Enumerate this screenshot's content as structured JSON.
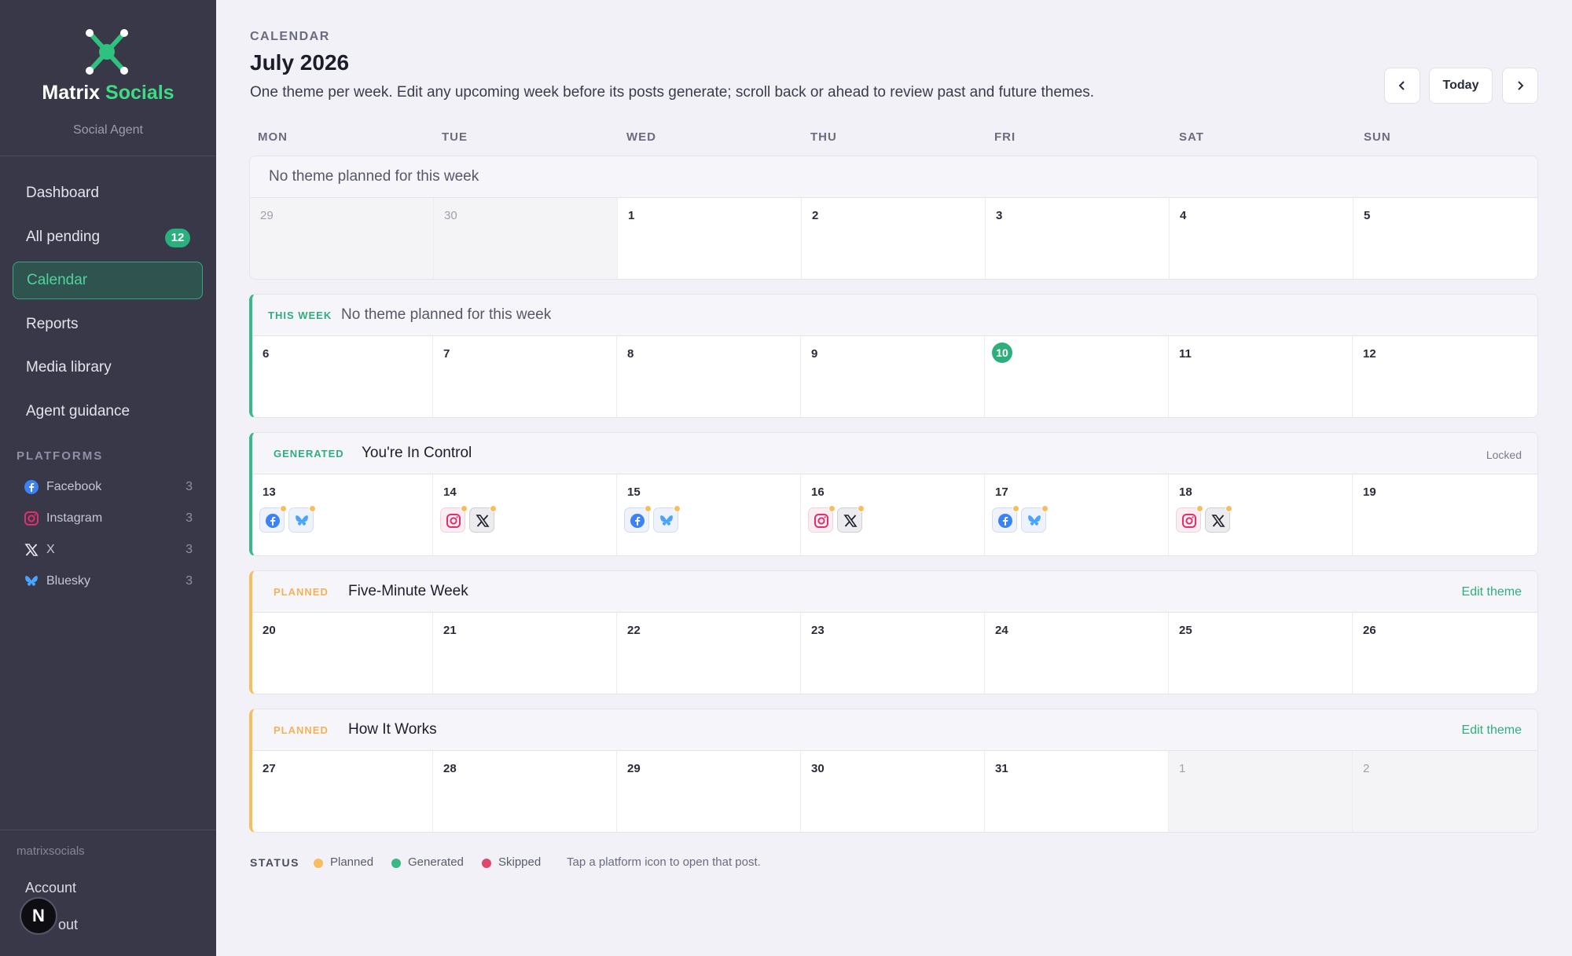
{
  "brand": {
    "name_a": "Matrix",
    "name_b": "Socials",
    "subtitle": "Social Agent"
  },
  "nav": [
    {
      "label": "Dashboard"
    },
    {
      "label": "All pending",
      "badge": "12"
    },
    {
      "label": "Calendar",
      "active": true
    },
    {
      "label": "Reports"
    },
    {
      "label": "Media library"
    },
    {
      "label": "Agent guidance"
    }
  ],
  "platforms_label": "PLATFORMS",
  "platforms": [
    {
      "label": "Facebook",
      "count": "3",
      "icon": "facebook-icon"
    },
    {
      "label": "Instagram",
      "count": "3",
      "icon": "instagram-icon"
    },
    {
      "label": "X",
      "count": "3",
      "icon": "x-icon"
    },
    {
      "label": "Bluesky",
      "count": "3",
      "icon": "bluesky-icon"
    }
  ],
  "footer": {
    "user": "matrixsocials",
    "account": "Account",
    "logout": "out",
    "n_badge": "N"
  },
  "header": {
    "kicker": "CALENDAR",
    "title": "July 2026",
    "description": "One theme per week. Edit any upcoming week before its posts generate; scroll back or ahead to review past and future themes.",
    "prev": "‹",
    "today": "Today",
    "next": "›"
  },
  "weekdays": [
    "MON",
    "TUE",
    "WED",
    "THU",
    "FRI",
    "SAT",
    "SUN"
  ],
  "weeks": [
    {
      "status": "",
      "theme": "No theme planned for this week",
      "right": "",
      "days": [
        "29",
        "30",
        "1",
        "2",
        "3",
        "4",
        "5"
      ]
    },
    {
      "status": "THIS WEEK",
      "theme": "No theme planned for this week",
      "right": "",
      "days": [
        "6",
        "7",
        "8",
        "9",
        "10",
        "11",
        "12"
      ]
    },
    {
      "status": "GENERATED",
      "theme": "You're In Control",
      "right": "Locked",
      "days": [
        "13",
        "14",
        "15",
        "16",
        "17",
        "18",
        "19"
      ]
    },
    {
      "status": "PLANNED",
      "theme": "Five-Minute Week",
      "right": "Edit theme",
      "days": [
        "20",
        "21",
        "22",
        "23",
        "24",
        "25",
        "26"
      ]
    },
    {
      "status": "PLANNED",
      "theme": "How It Works",
      "right": "Edit theme",
      "days": [
        "27",
        "28",
        "29",
        "30",
        "31",
        "1",
        "2"
      ]
    }
  ],
  "legend": {
    "title": "STATUS",
    "items": [
      {
        "label": "Planned",
        "color": "#f7bd5e"
      },
      {
        "label": "Generated",
        "color": "#3ab887"
      },
      {
        "label": "Skipped",
        "color": "#e0486b"
      }
    ],
    "hint": "Tap a platform icon to open that post."
  },
  "colors": {
    "accent": "#3ddc84",
    "planned": "#f7bd5e",
    "generated": "#3ab887",
    "skipped": "#e0486b"
  }
}
